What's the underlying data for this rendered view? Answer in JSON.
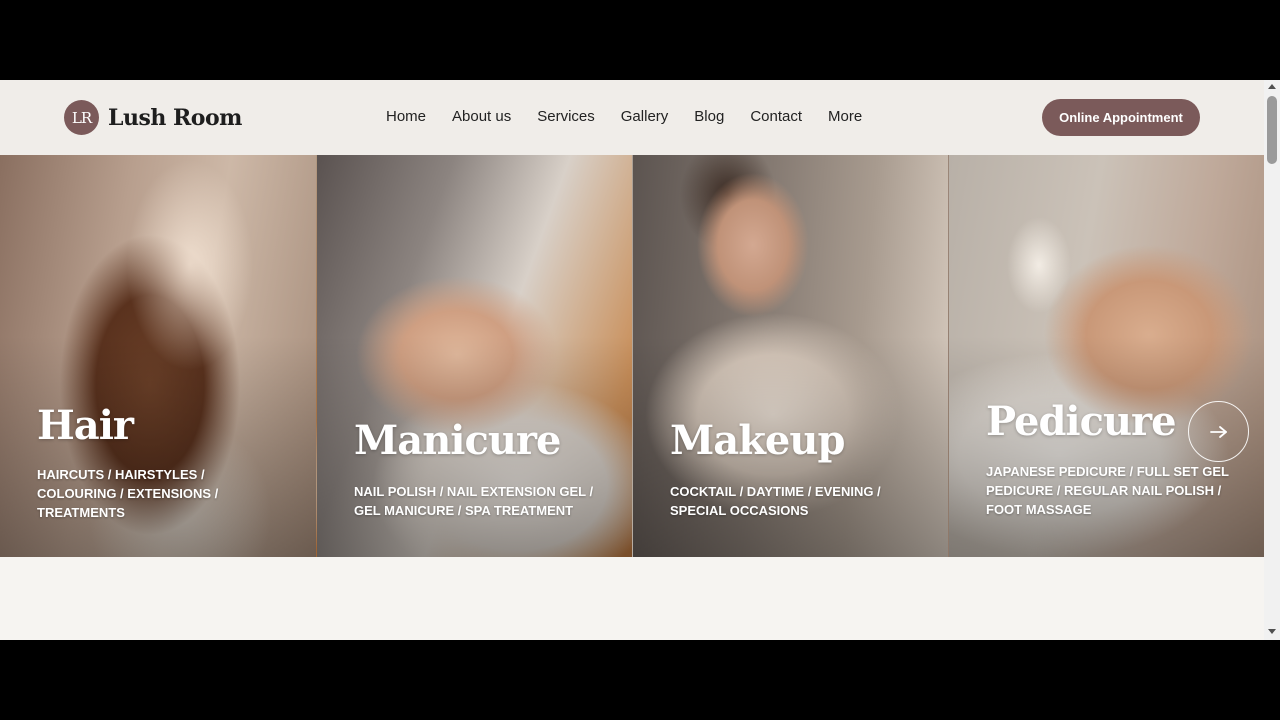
{
  "brand": {
    "monogram": "LR",
    "name": "Lush Room",
    "accent_color": "#7b5a5a"
  },
  "nav": {
    "items": [
      {
        "label": "Home"
      },
      {
        "label": "About us"
      },
      {
        "label": "Services"
      },
      {
        "label": "Gallery"
      },
      {
        "label": "Blog"
      },
      {
        "label": "Contact"
      },
      {
        "label": "More"
      }
    ]
  },
  "cta": {
    "label": "Online Appointment"
  },
  "services": [
    {
      "title": "Hair",
      "description": "HAIRCUTS / HAIRSTYLES / COLOURING / EXTENSIONS / TREATMENTS"
    },
    {
      "title": "Manicure",
      "description": "NAIL POLISH / NAIL EXTENSION GEL / GEL MANICURE / SPA TREATMENT"
    },
    {
      "title": "Makeup",
      "description": "COCKTAIL / DAYTIME / EVENING / SPECIAL OCCASIONS"
    },
    {
      "title": "Pedicure",
      "description": "JAPANESE PEDICURE / FULL SET GEL PEDICURE / REGULAR NAIL POLISH / FOOT MASSAGE"
    }
  ],
  "carousel": {
    "next_icon": "arrow-right-icon"
  }
}
